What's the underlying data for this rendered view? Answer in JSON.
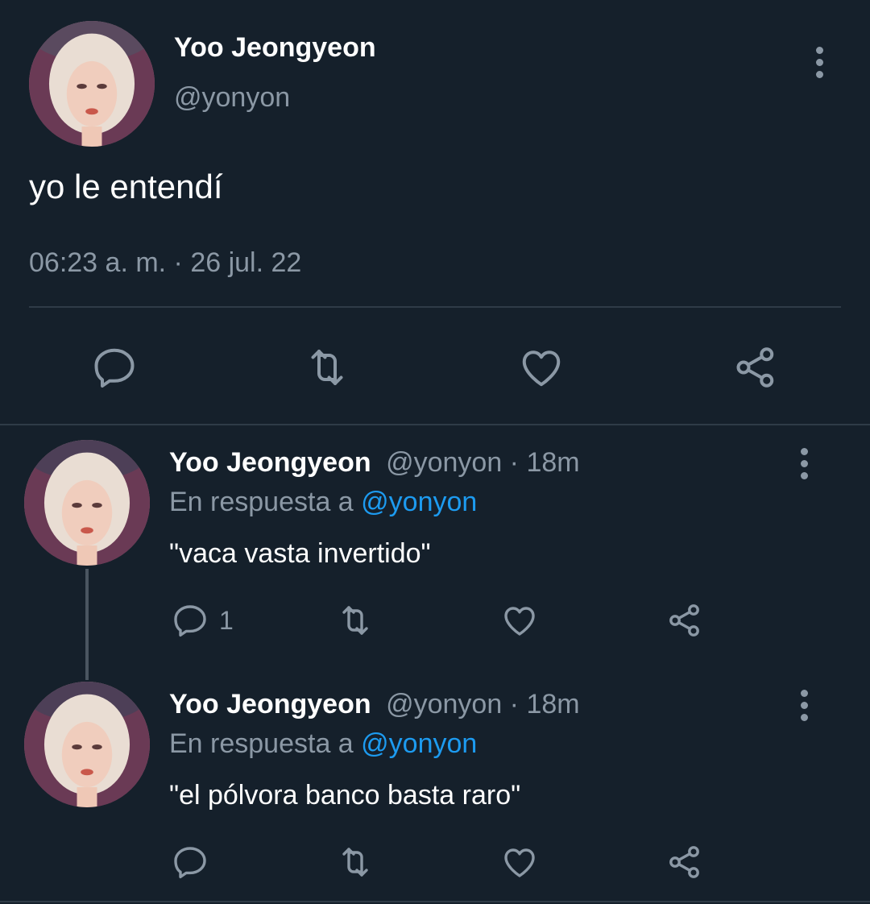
{
  "main_tweet": {
    "author_name": "Yoo Jeongyeon",
    "handle": "@yonyon",
    "text": "yo le entendí",
    "timestamp": "06:23 a. m. · 26 jul. 22"
  },
  "replies": [
    {
      "author_name": "Yoo Jeongyeon",
      "handle_time": "@yonyon · 18m",
      "reply_prefix": "En respuesta a",
      "reply_to": "@yonyon",
      "text": "\"vaca vasta invertido\"",
      "reply_count": "1"
    },
    {
      "author_name": "Yoo Jeongyeon",
      "handle_time": "@yonyon · 18m",
      "reply_prefix": "En respuesta a",
      "reply_to": "@yonyon",
      "text": "\"el pólvora banco basta raro\"",
      "reply_count": ""
    }
  ],
  "icons": {
    "reply": "reply-icon",
    "retweet": "retweet-icon",
    "like": "like-icon",
    "share": "share-icon",
    "more": "more-options-icon"
  },
  "colors": {
    "background": "#15202b",
    "text": "#ffffff",
    "muted": "#8b98a5",
    "link": "#1d9bf0",
    "divider": "#2f3b47"
  }
}
